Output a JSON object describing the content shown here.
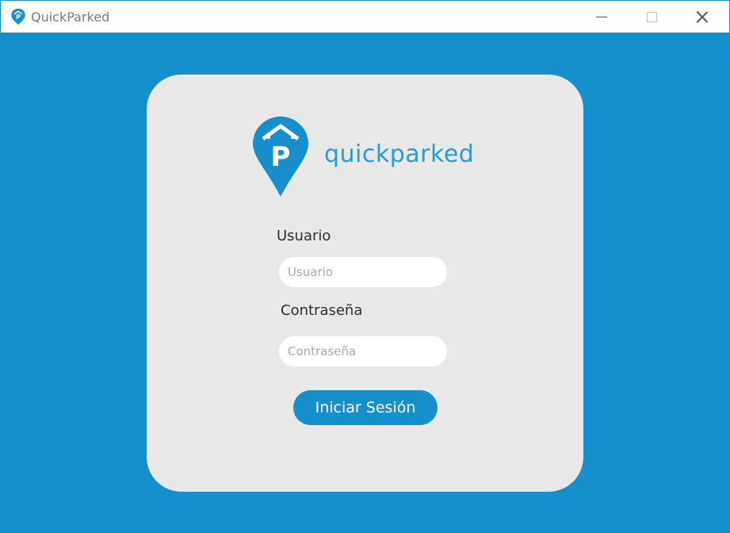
{
  "window": {
    "title": "QuickParked",
    "app_icon": "pin-parking-icon",
    "controls": [
      "minimize-icon",
      "maximize-icon",
      "close-icon"
    ]
  },
  "brand": {
    "logo_icon": "pin-parking-icon",
    "logo_text": "quickparked",
    "accent_color": "#1590cc",
    "card_color": "#e8e8e8"
  },
  "login": {
    "user_label": "Usuario",
    "user_placeholder": "Usuario",
    "user_value": "",
    "password_label": "Contraseña",
    "password_placeholder": "Contraseña",
    "password_value": "",
    "submit_label": "Iniciar Sesión"
  }
}
